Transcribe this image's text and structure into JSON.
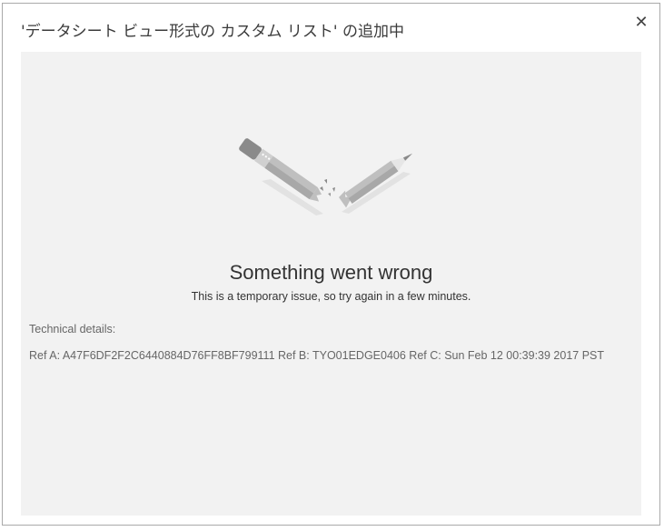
{
  "dialog": {
    "title": "'データシート ビュー形式の カスタム リスト' の追加中",
    "close_label": "✕"
  },
  "error": {
    "heading": "Something went wrong",
    "message": "This is a temporary issue, so try again in a few minutes.",
    "technical_label": "Technical details:",
    "refs": "Ref A: A47F6DF2F2C6440884D76FF8BF799111 Ref B: TYO01EDGE0406 Ref C: Sun Feb 12 00:39:39 2017 PST"
  },
  "icons": {
    "illustration": "broken-pencil-icon",
    "close": "close-icon"
  },
  "colors": {
    "panel_bg": "#f2f2f2",
    "border": "#a9a9a9",
    "text_dark": "#333333",
    "text_muted": "#666666"
  }
}
